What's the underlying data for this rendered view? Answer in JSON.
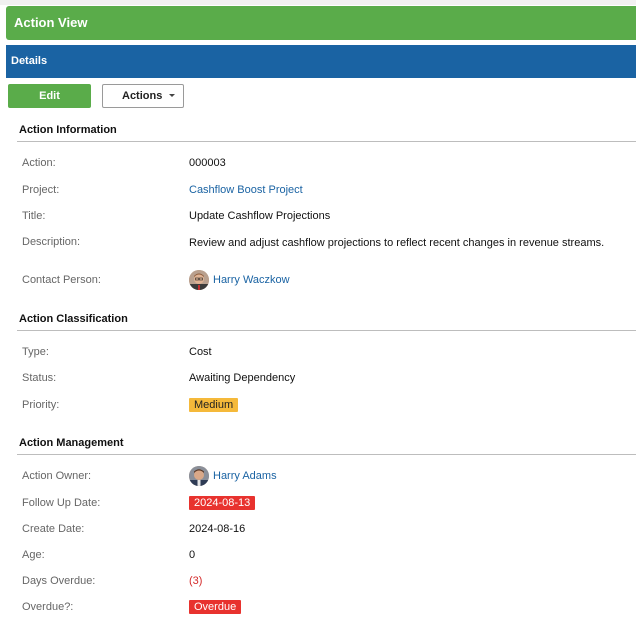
{
  "window": {
    "title": "Action View"
  },
  "details_header": "Details",
  "toolbar": {
    "edit_label": "Edit",
    "actions_label": "Actions"
  },
  "sections": {
    "information": {
      "title": "Action Information",
      "action": {
        "label": "Action:",
        "value": "000003"
      },
      "project": {
        "label": "Project:",
        "value": "Cashflow Boost Project"
      },
      "title_field": {
        "label": "Title:",
        "value": "Update Cashflow Projections"
      },
      "description": {
        "label": "Description:",
        "value": "Review and adjust cashflow projections to reflect recent changes in revenue streams."
      },
      "contact": {
        "label": "Contact Person:",
        "value": "Harry Waczkow"
      }
    },
    "classification": {
      "title": "Action Classification",
      "type": {
        "label": "Type:",
        "value": "Cost"
      },
      "status": {
        "label": "Status:",
        "value": "Awaiting Dependency"
      },
      "priority": {
        "label": "Priority:",
        "value": "Medium",
        "color": "#f5b93a"
      }
    },
    "management": {
      "title": "Action Management",
      "owner": {
        "label": "Action Owner:",
        "value": "Harry Adams"
      },
      "follow_up": {
        "label": "Follow Up Date:",
        "value": "2024-08-13",
        "color": "#e8322e"
      },
      "create_date": {
        "label": "Create Date:",
        "value": "2024-08-16"
      },
      "age": {
        "label": "Age:",
        "value": "0"
      },
      "days_overdue": {
        "label": "Days Overdue:",
        "value": "(3)",
        "color": "#d42a2a"
      },
      "overdue": {
        "label": "Overdue?:",
        "value": "Overdue",
        "color": "#e8322e"
      }
    }
  },
  "colors": {
    "green": "#5aac4a",
    "blue": "#1a63a3",
    "link": "#1a63a3"
  },
  "icons": {
    "avatar": "user-avatar-icon",
    "caret": "caret-down-icon"
  }
}
